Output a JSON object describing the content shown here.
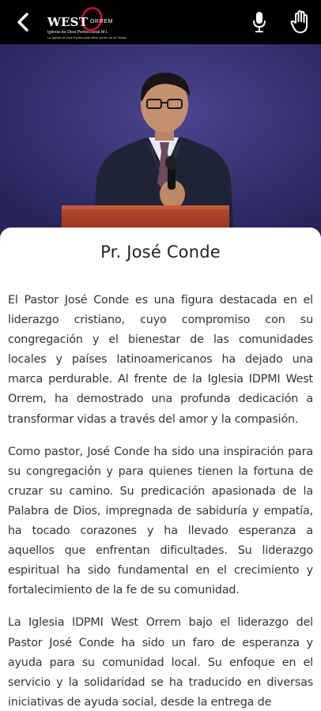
{
  "header": {
    "back_icon": "chevron-left-icon",
    "logo": {
      "word_main": "WEST",
      "word_script": "ORREM",
      "subtitle": "Iglesia de Dios Pentecostal M.I.",
      "subtitle_small": "La Iglesia de Dios Pentecostal West Orrem de la Florida"
    },
    "mic_icon": "microphone-icon",
    "hand_icon": "raised-hand-icon"
  },
  "hero": {
    "image": "photo-of-pastor-speaking-at-podium"
  },
  "profile": {
    "name": "Pr. José Conde",
    "paragraphs": [
      "El Pastor José Conde es una figura destacada en el liderazgo cristiano, cuyo compromiso con su congregación y el bienestar de las comunidades locales y países latinoamericanos ha dejado una marca perdurable. Al frente de la Iglesia IDPMI West Orrem, ha demostrado una profunda dedicación a transformar vidas a través del amor y la compasión.",
      "Como pastor, José Conde ha sido una inspiración para su congregación y para quienes tienen la fortuna de cruzar su camino. Su predicación apasionada de la Palabra de Dios, impregnada de sabiduría y empatía, ha tocado corazones y ha llevado esperanza a aquellos que enfrentan dificultades. Su liderazgo espiritual ha sido fundamental en el crecimiento y fortalecimiento de la fe de su comunidad.",
      "La Iglesia IDPMI West Orrem bajo el liderazgo del Pastor José Conde ha sido un faro de esperanza y ayuda para su comunidad local. Su enfoque en el servicio y la solidaridad se ha traducido en diversas iniciativas de ayuda social, desde la entrega de"
    ]
  },
  "colors": {
    "topbar": "#000000",
    "logo_accent": "#c8102e",
    "text": "#333333",
    "title": "#222222"
  }
}
